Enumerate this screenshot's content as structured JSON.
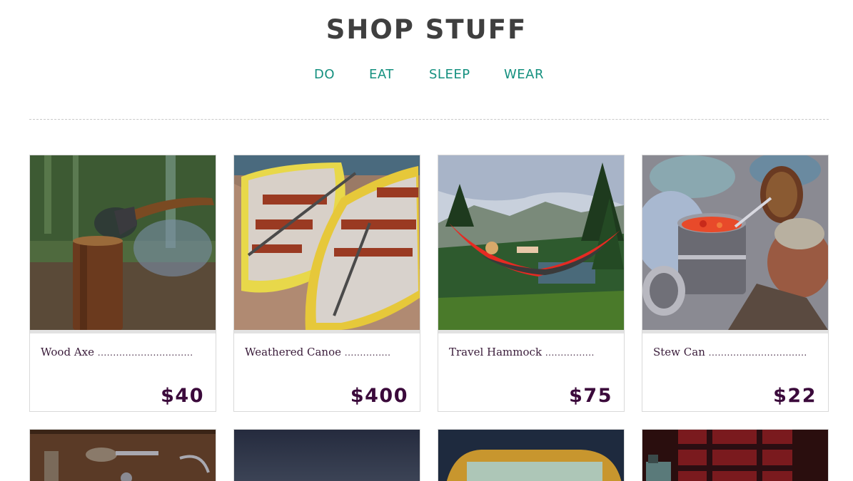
{
  "header": {
    "title": "SHOP STUFF"
  },
  "nav": {
    "items": [
      "DO",
      "EAT",
      "SLEEP",
      "WEAR"
    ]
  },
  "products": [
    {
      "name": "Wood Axe",
      "dots": "...............................",
      "price": "$40",
      "image": "axe-in-stump-photo"
    },
    {
      "name": "Weathered Canoe",
      "dots": "...............",
      "price": "$400",
      "image": "canoes-on-dock-photo"
    },
    {
      "name": "Travel Hammock",
      "dots": "................",
      "price": "$75",
      "image": "hammock-mountains-photo"
    },
    {
      "name": "Stew Can",
      "dots": "................................",
      "price": "$22",
      "image": "stew-pot-pinecone-photo"
    }
  ],
  "next_row_images": [
    "tools-on-wood-photo",
    "night-sky-photo",
    "bag-basket-photo",
    "flask-plaid-photo"
  ],
  "colors": {
    "title": "#3f3f3f",
    "nav": "#14907f",
    "price": "#3b0a3b",
    "text": "#3a1c3a"
  }
}
